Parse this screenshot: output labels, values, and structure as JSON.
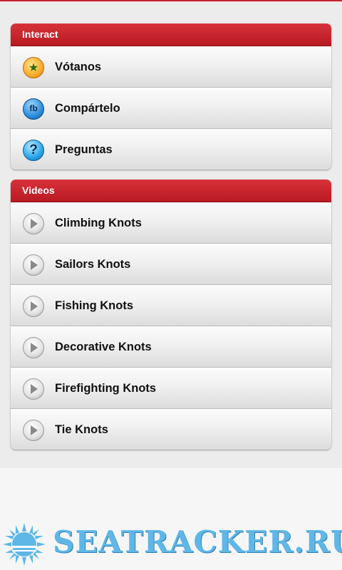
{
  "sections": [
    {
      "title": "Interact",
      "items": [
        {
          "label": "Vótanos",
          "icon": "star-icon"
        },
        {
          "label": "Compártelo",
          "icon": "facebook-icon"
        },
        {
          "label": "Preguntas",
          "icon": "question-icon"
        }
      ]
    },
    {
      "title": "Videos",
      "items": [
        {
          "label": "Climbing Knots",
          "icon": "play-icon"
        },
        {
          "label": "Sailors Knots",
          "icon": "play-icon"
        },
        {
          "label": "Fishing Knots",
          "icon": "play-icon"
        },
        {
          "label": "Decorative Knots",
          "icon": "play-icon"
        },
        {
          "label": "Firefighting Knots",
          "icon": "play-icon"
        },
        {
          "label": "Tie Knots",
          "icon": "play-icon"
        }
      ]
    }
  ],
  "icon_glyphs": {
    "star": "★",
    "facebook": "fb",
    "question": "?"
  },
  "watermark": {
    "text": "SEATRACKER.RU"
  },
  "colors": {
    "header_red": "#c8222b",
    "watermark_blue": "#5fb7e7"
  }
}
